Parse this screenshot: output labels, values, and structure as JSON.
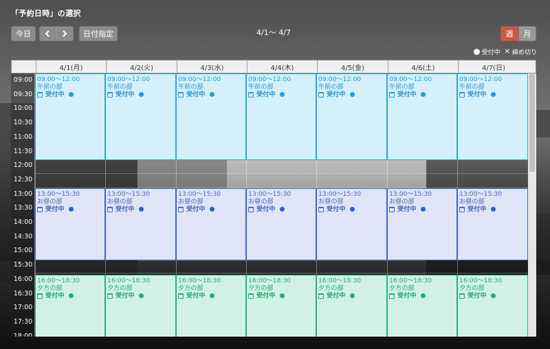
{
  "page": {
    "title": "「予約日時」の選択"
  },
  "toolbar": {
    "today_label": "今日",
    "prev_label": "‹",
    "next_label": "›",
    "date_label": "日付指定",
    "range": "4/1〜 4/7",
    "week_label": "週",
    "month_label": "月"
  },
  "legend": {
    "open_label": "受付中",
    "closed_label": "締め切り",
    "closed_mark": "✕"
  },
  "days": [
    "4/1(月)",
    "4/2(火)",
    "4/3(水)",
    "4/4(木)",
    "4/5(金)",
    "4/6(土)",
    "4/7(日)"
  ],
  "times": [
    "09:00",
    "09:30",
    "10:00",
    "10:30",
    "11:00",
    "11:30",
    "12:00",
    "12:30",
    "13:00",
    "13:30",
    "14:00",
    "14:30",
    "15:00",
    "15:30",
    "16:00",
    "16:30",
    "17:00",
    "17:30",
    "18:00"
  ],
  "events": {
    "am": {
      "time": "09:00〜12:00",
      "name": "午前の部",
      "status": "受付中"
    },
    "pm": {
      "time": "13:00〜15:30",
      "name": "お昼の部",
      "status": "受付中"
    },
    "ev": {
      "time": "16:00〜18:30",
      "name": "夕方の部",
      "status": "受付中"
    }
  },
  "colors": {
    "am": "#2fa6d6",
    "pm": "#3e64c5",
    "ev": "#26b07e",
    "week_active": "#c75c44"
  }
}
